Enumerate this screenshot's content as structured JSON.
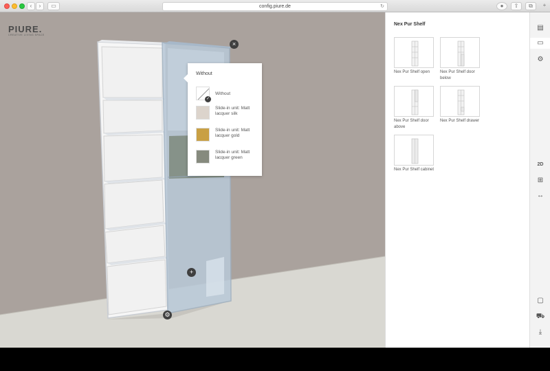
{
  "browser": {
    "url": "config.piure.de"
  },
  "logo": {
    "name": "PIURE.",
    "tagline": "CREATIVE LIVING SPACE"
  },
  "popup": {
    "title": "Without",
    "options": [
      {
        "label": "Without",
        "color": "#ffffff",
        "selected": true
      },
      {
        "label": "Slide-in unit: Matt lacquer silk",
        "color": "#dcd4cc",
        "selected": false
      },
      {
        "label": "Slide-in unit: Matt lacquer gold",
        "color": "#c9a044",
        "selected": false
      },
      {
        "label": "Slide-in unit: Matt lacquer green",
        "color": "#868a7e",
        "selected": false
      }
    ]
  },
  "panel": {
    "title": "Nex Pur Shelf",
    "products": [
      {
        "caption": "Nex Pur Shelf open"
      },
      {
        "caption": "Nex Pur Shelf door below"
      },
      {
        "caption": "Nex Pur Shelf door above"
      },
      {
        "caption": "Nex Pur Shelf drawer"
      },
      {
        "caption": "Nex Pur Shelf cabinet"
      }
    ]
  },
  "toolbar": {
    "view2d_label": "2D"
  },
  "colors": {
    "wall": "#aaa29d",
    "floor": "#d9d8d2",
    "glass": "#b8c8d8",
    "dark_icon": "#3f3f3f"
  }
}
